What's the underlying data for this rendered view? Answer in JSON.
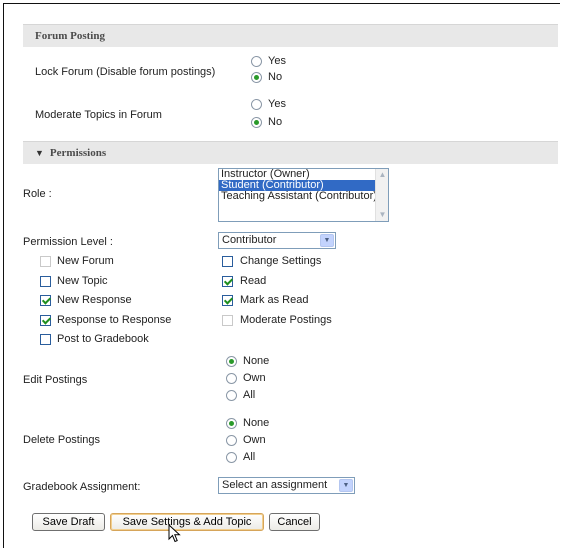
{
  "forum_posting": {
    "header": "Forum Posting",
    "lock": {
      "label": "Lock Forum (Disable forum postings)",
      "yes": "Yes",
      "no": "No",
      "selected": "no"
    },
    "moderate": {
      "label": "Moderate Topics in Forum",
      "yes": "Yes",
      "no": "No",
      "selected": "no"
    }
  },
  "permissions": {
    "header": "Permissions",
    "role_label": "Role :",
    "roles": [
      "Instructor (Owner)",
      "Student (Contributor)",
      "Teaching Assistant (Contributor)"
    ],
    "selected_role": "Student (Contributor)",
    "permission_level_label": "Permission Level :",
    "permission_level_value": "Contributor",
    "checkboxes": {
      "new_forum": {
        "label": "New Forum",
        "checked": false,
        "enabled": false
      },
      "change_settings": {
        "label": "Change Settings",
        "checked": false,
        "enabled": true
      },
      "new_topic": {
        "label": "New Topic",
        "checked": false,
        "enabled": true
      },
      "read": {
        "label": "Read",
        "checked": true,
        "enabled": true
      },
      "new_response": {
        "label": "New Response",
        "checked": true,
        "enabled": true
      },
      "mark_as_read": {
        "label": "Mark as Read",
        "checked": true,
        "enabled": true
      },
      "response_to_response": {
        "label": "Response to Response",
        "checked": true,
        "enabled": true
      },
      "moderate_postings": {
        "label": "Moderate Postings",
        "checked": false,
        "enabled": false
      },
      "post_to_gradebook": {
        "label": "Post to Gradebook",
        "checked": false,
        "enabled": true
      }
    },
    "edit_postings": {
      "label": "Edit Postings",
      "none": "None",
      "own": "Own",
      "all": "All",
      "selected": "none"
    },
    "delete_postings": {
      "label": "Delete Postings",
      "none": "None",
      "own": "Own",
      "all": "All",
      "selected": "none"
    },
    "gradebook_label": "Gradebook Assignment:",
    "gradebook_value": "Select an assignment"
  },
  "buttons": {
    "save_draft": "Save Draft",
    "save_settings": "Save Settings & Add Topic",
    "cancel": "Cancel"
  }
}
